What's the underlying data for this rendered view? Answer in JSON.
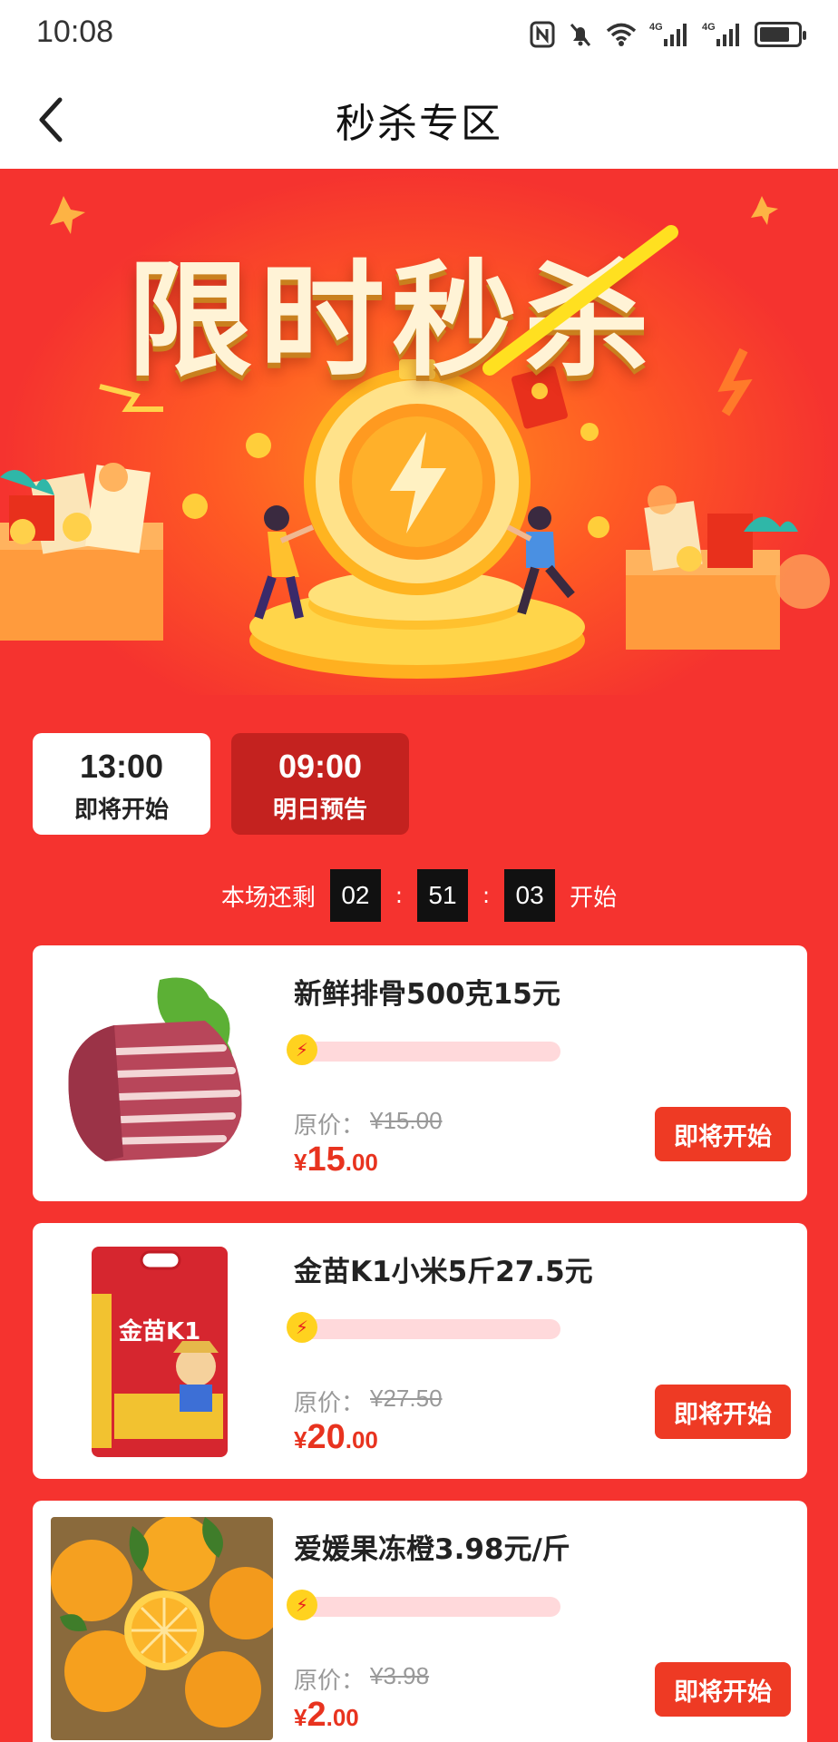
{
  "status_bar": {
    "time": "10:08",
    "icons": [
      "nfc-icon",
      "mute-bell-icon",
      "wifi-icon",
      "signal-4g-icon",
      "signal-4g-icon",
      "battery-icon"
    ],
    "signal_label": "4G",
    "battery_level": 0.8
  },
  "header": {
    "title": "秒杀专区",
    "back_icon": "chevron-left-icon"
  },
  "banner": {
    "title": "限时秒杀"
  },
  "sessions": [
    {
      "time": "13:00",
      "label": "即将开始",
      "active": true
    },
    {
      "time": "09:00",
      "label": "明日预告",
      "active": false
    }
  ],
  "countdown": {
    "prefix": "本场还剩",
    "hours": "02",
    "minutes": "51",
    "seconds": "03",
    "separator": ":",
    "suffix": "开始"
  },
  "products": [
    {
      "name": "新鲜排骨500克15元",
      "original_label": "原价：",
      "original_price": "¥15.00",
      "currency": "¥",
      "price_int": "15",
      "price_dec": ".00",
      "progress": 0,
      "button": "即将开始",
      "image": "pork-ribs-image"
    },
    {
      "name": "金苗K1小米5斤27.5元",
      "original_label": "原价：",
      "original_price": "¥27.50",
      "currency": "¥",
      "price_int": "20",
      "price_dec": ".00",
      "progress": 0,
      "button": "即将开始",
      "image": "millet-bag-image",
      "image_text": "金苗K1"
    },
    {
      "name": "爱媛果冻橙3.98元/斤",
      "original_label": "原价：",
      "original_price": "¥3.98",
      "currency": "¥",
      "price_int": "2",
      "price_dec": ".00",
      "progress": 0,
      "button": "即将开始",
      "image": "oranges-image"
    }
  ],
  "colors": {
    "page_bg": "#f5332f",
    "accent_red": "#ee3a24",
    "price_red": "#e8331f",
    "tab_inactive": "#c4221f",
    "progress_track": "#ffd9db",
    "bolt_yellow": "#ffd21f"
  }
}
